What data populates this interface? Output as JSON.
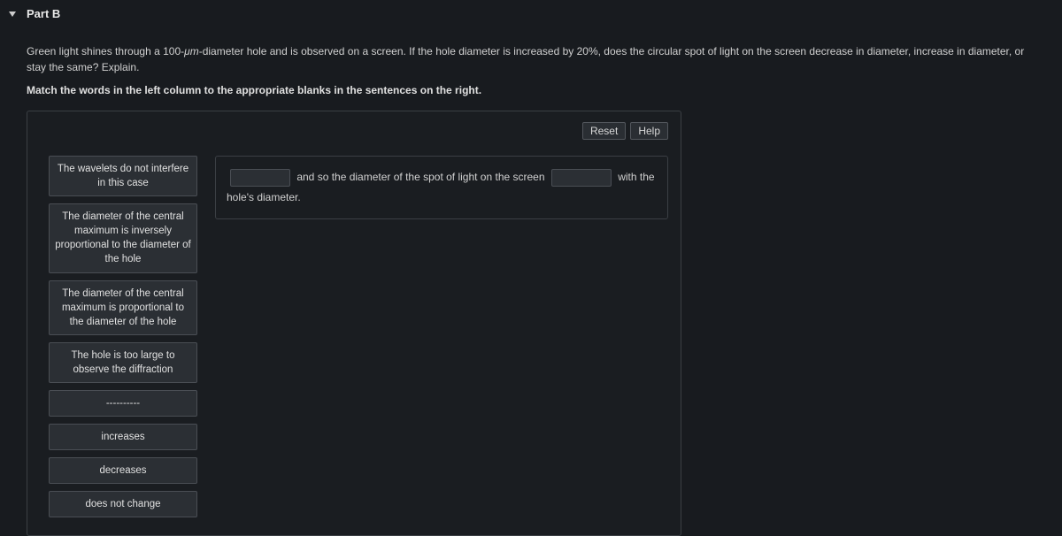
{
  "header": {
    "title": "Part B"
  },
  "question": {
    "pre": "Green light shines through a 100-",
    "unit": "μm",
    "post": "-diameter hole and is observed on a screen. If the hole diameter is increased by 20%, does the circular spot of light on the screen decrease in diameter, increase in diameter, or stay the same? Explain."
  },
  "instruction": "Match the words in the left column to the appropriate blanks in the sentences on the right.",
  "toolbar": {
    "reset": "Reset",
    "help": "Help"
  },
  "draggables": [
    "The wavelets do not interfere in this case",
    "The diameter of the central maximum is inversely proportional to the diameter of the hole",
    "The diameter of the central maximum is proportional to the diameter of the hole",
    "The hole is too large to observe the diffraction",
    "----------",
    "increases",
    "decreases",
    "does not change"
  ],
  "sentence": {
    "seg1": " and so the diameter of the spot of light on the screen ",
    "seg2": " with the hole's diameter."
  }
}
